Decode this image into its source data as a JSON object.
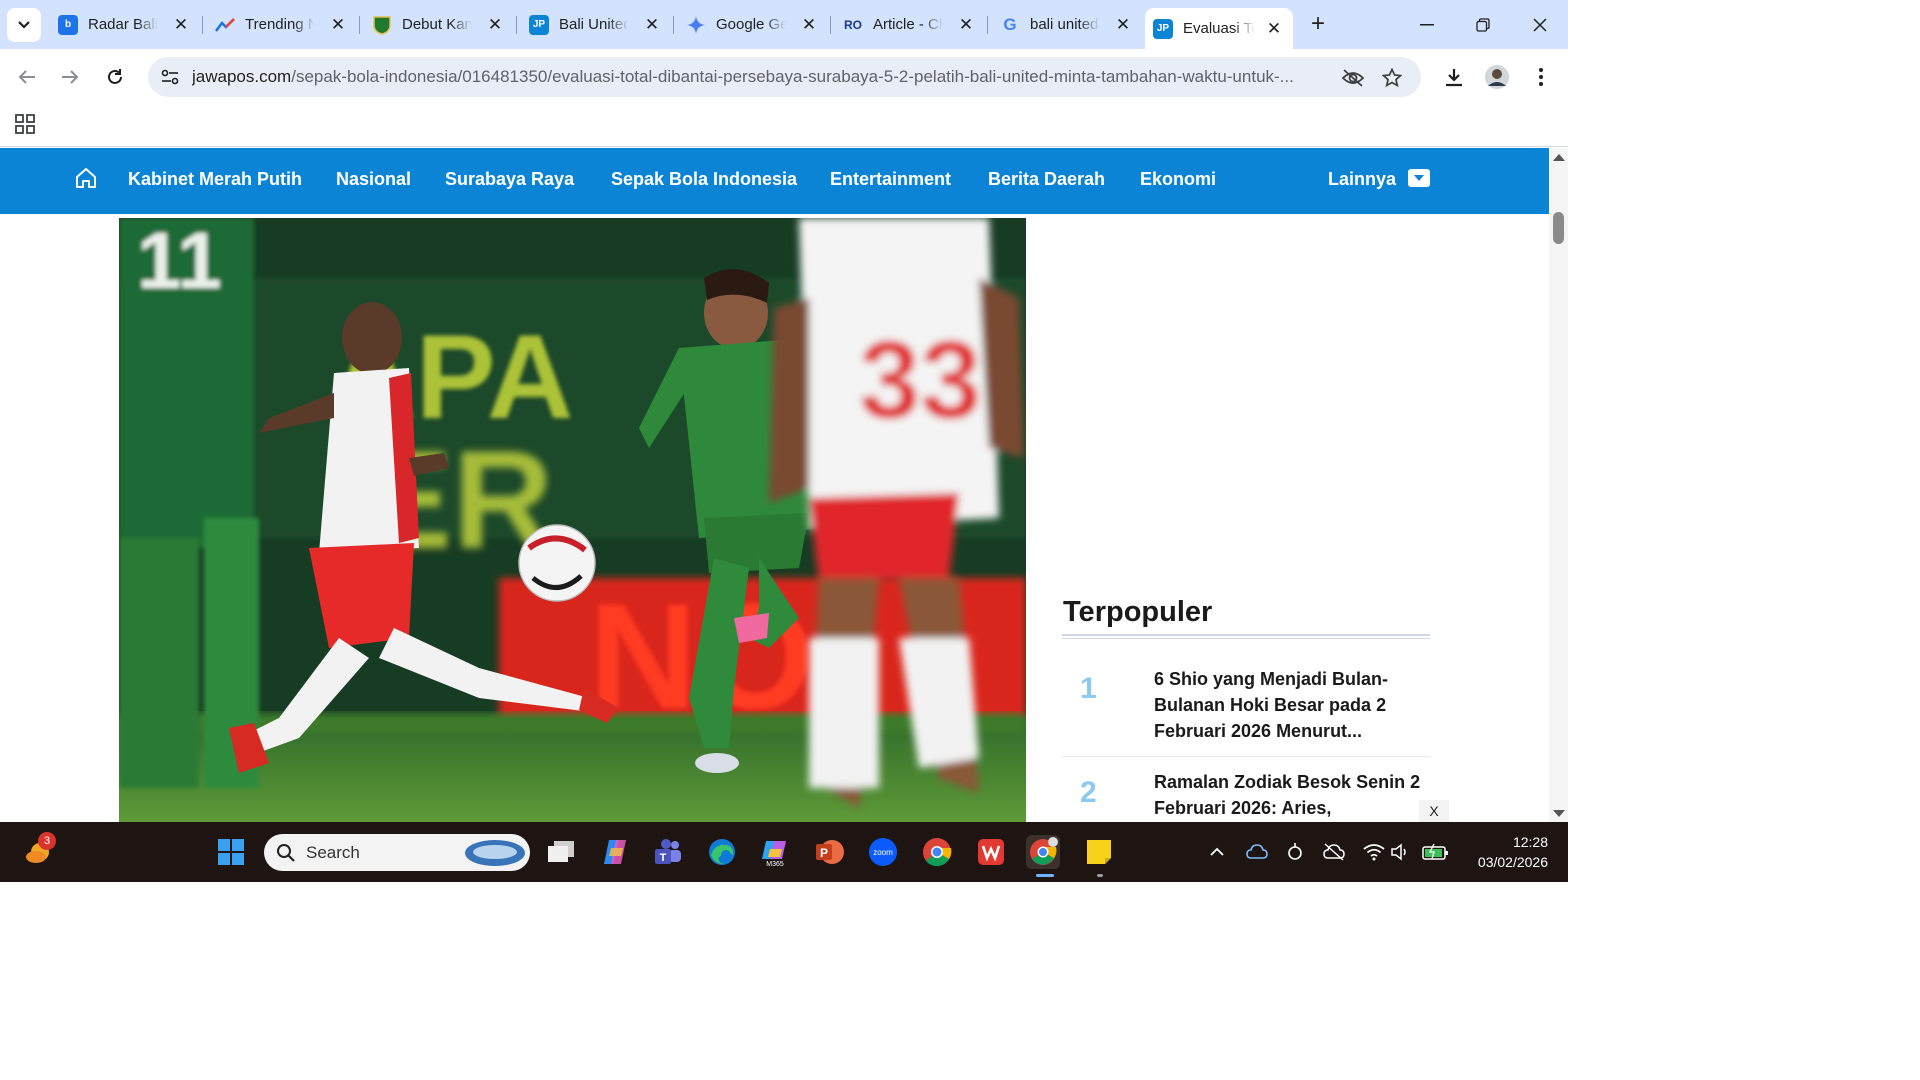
{
  "browser": {
    "tabs": [
      {
        "title": "Radar Bali",
        "icon": "radar-bali-favicon",
        "color": "#1e73e8",
        "glyph": "b"
      },
      {
        "title": "Trending Now",
        "icon": "trending-chart-favicon",
        "color": "#ffffff",
        "glyph": ""
      },
      {
        "title": "Debut Kane",
        "icon": "persebaya-favicon",
        "color": "#1f7a2f",
        "glyph": ""
      },
      {
        "title": "Bali United",
        "icon": "jawapos-favicon",
        "color": "#0c84d5",
        "glyph": "JP"
      },
      {
        "title": "Google Gemini",
        "icon": "gemini-favicon",
        "color": "#ffffff",
        "glyph": ""
      },
      {
        "title": "Article - Chat",
        "icon": "article-favicon",
        "color": "#ffffff",
        "glyph": "RO"
      },
      {
        "title": "bali united",
        "icon": "google-favicon",
        "color": "#ffffff",
        "glyph": "G"
      },
      {
        "title": "Evaluasi Total",
        "icon": "jawapos-favicon",
        "color": "#0c84d5",
        "glyph": "JP"
      }
    ],
    "url_host": "jawapos.com",
    "url_path": "/sepak-bola-indonesia/016481350/evaluasi-total-dibantai-persebaya-surabaya-5-2-pelatih-bali-united-minta-tambahan-waktu-untuk-..."
  },
  "site": {
    "nav": [
      "Kabinet Merah Putih",
      "Nasional",
      "Surabaya Raya",
      "Sepak Bola Indonesia",
      "Entertainment",
      "Berita Daerah",
      "Ekonomi"
    ],
    "more_label": "Lainnya",
    "accent": "#0c84d5"
  },
  "sidebar": {
    "title": "Terpopuler",
    "items": [
      {
        "rank": "1",
        "text": "6 Shio yang Menjadi Bulan-Bulanan Hoki Besar pada 2 Februari 2026 Menurut..."
      },
      {
        "rank": "2",
        "text": "Ramalan Zodiak Besok Senin 2 Februari 2026: Aries,"
      }
    ],
    "close_label": "X"
  },
  "hero": {
    "jersey_numbers": [
      "11",
      "33"
    ],
    "banner_text": [
      "APA",
      "ER",
      "NO"
    ]
  },
  "taskbar": {
    "search_label": "Search",
    "weather_badge": "3",
    "time": "12:28",
    "date": "03/02/2026",
    "apps": [
      "windows-start",
      "search",
      "task-view",
      "copilot",
      "teams",
      "edge",
      "m365",
      "powerpoint",
      "zoom",
      "chrome",
      "wps",
      "chrome-profile",
      "sticky-notes"
    ]
  }
}
